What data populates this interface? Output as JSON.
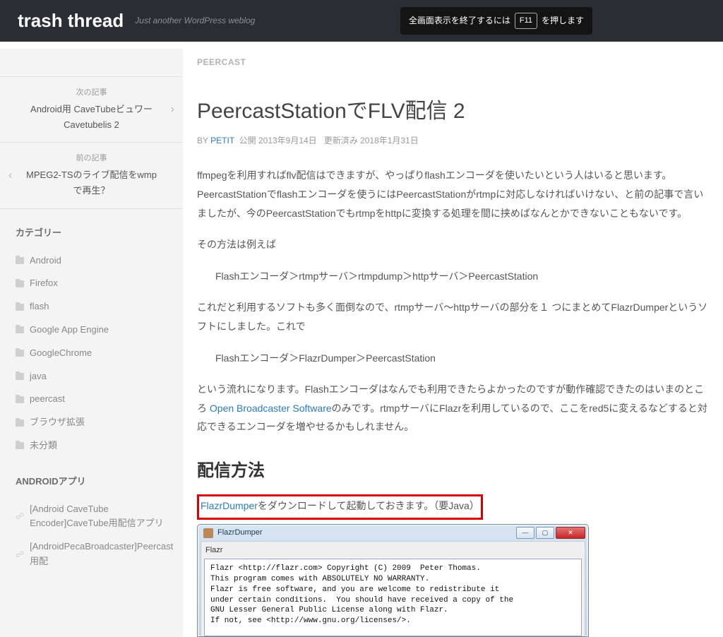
{
  "header": {
    "site_title": "trash thread",
    "tagline": "Just another WordPress weblog",
    "fs_before": "全画面表示を終了するには",
    "fs_key": "F11",
    "fs_after": "を押します"
  },
  "sidebar": {
    "next": {
      "label": "次の記事",
      "title": "Android用 CaveTubeビュワー Cavetubelis 2"
    },
    "prev": {
      "label": "前の記事",
      "title": "MPEG2-TSのライブ配信をwmpで再生？"
    },
    "cat_heading": "カテゴリー",
    "categories": [
      "Android",
      "Firefox",
      "flash",
      "Google App Engine",
      "GoogleChrome",
      "java",
      "peercast",
      "ブラウザ拡張",
      "未分類"
    ],
    "app_heading": "ANDROIDアプリ",
    "apps": [
      "[Android CaveTube Encoder]CaveTube用配信アプリ",
      "[AndroidPecaBroadcaster]Peercast用配"
    ]
  },
  "post": {
    "crumb": "PEERCAST",
    "title": "PeercastStationでFLV配信 2",
    "meta_by": "BY",
    "meta_author": "PETIT",
    "meta_pub_label": "公開",
    "meta_pub_date": "2013年9月14日",
    "meta_upd_label": "更新済み",
    "meta_upd_date": "2018年1月31日",
    "p1": "ffmpegを利用すればflv配信はできますが、やっぱりflashエンコーダを使いたいという人はいると思います。PeercastStationでflashエンコーダを使うにはPeercastStationがrtmpに対応しなければいけない、と前の記事で言いましたが、今のPeercastStationでもrtmpをhttpに変換する処理を間に挟めばなんとかできないこともないです。",
    "p2": "その方法は例えば",
    "p3": "Flashエンコーダ＞rtmpサーバ＞rtmpdump＞httpサーバ＞PeercastStation",
    "p4": "これだと利用するソフトも多く面倒なので、rtmpサーバ〜httpサーバの部分を１ つにまとめてFlazrDumperというソフトにしました。これで",
    "p5": "Flashエンコーダ＞FlazrDumper＞PeercastStation",
    "p6a": "という流れになります。Flashエンコーダはなんでも利用できたらよかったのですが動作確認できたのはいまのところ",
    "p6link": "Open Broadcaster Software",
    "p6b": "のみです。rtmpサーバにFlazrを利用しているので、ここをred5に変えるなどすると対応できるエンコーダを増やせるかもしれません。",
    "h2": "配信方法",
    "p7link": "FlazrDumper",
    "p7rest": "をダウンロードして起動しておきます。（要Java）",
    "win_title": "FlazrDumper",
    "win_group": "Flazr",
    "console": "Flazr <http://flazr.com> Copyright (C) 2009  Peter Thomas.\nThis program comes with ABSOLUTELY NO WARRANTY.\nFlazr is free software, and you are welcome to redistribute it\nunder certain conditions.  You should have received a copy of the\nGNU Lesser General Public License along with Flazr.\nIf not, see <http://www.gnu.org/licenses/>."
  }
}
